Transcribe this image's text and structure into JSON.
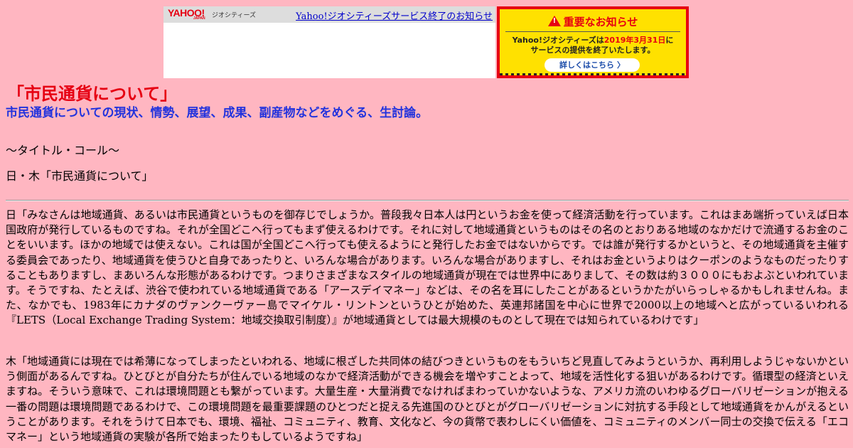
{
  "banner": {
    "logo_text": "YAHOO!",
    "logo_sub": "JAPAN",
    "service_label": "ジオシティーズ",
    "notice_link": "Yahoo!ジオシティーズサービス終了のお知らせ",
    "important_heading": "重要なお知らせ",
    "message_prefix": "Yahoo!ジオシティーズは",
    "message_date": "2019年3月31日",
    "message_mid": "に",
    "message_line2": "サービスの提供を終了いたします。",
    "detail_button": "詳しくはこちら",
    "detail_chevron": "〉",
    "colors": {
      "accent_red": "#e60012",
      "notice_yellow": "#ffe100",
      "link_blue": "#0000cc"
    }
  },
  "page": {
    "title": "「市民通貨について」",
    "subtitle": "市民通貨についての現状、情勢、展望、成果、副産物などをめぐる、生討論。",
    "title_call": "～タイトル・コール～",
    "speakers_line": "日・木「市民通貨について」",
    "colors": {
      "background": "#ffb6c1",
      "title": "#e60012",
      "subtitle": "#2233dd"
    }
  },
  "dialogue": [
    "日「みなさんは地域通貨、あるいは市民通貨というものを御存じでしょうか。普段我々日本人は円というお金を使って経済活動を行っています。これはまあ端折っていえば日本国政府が発行しているものですね。それが全国どこへ行ってもまず使えるわけです。それに対して地域通貨というものはその名のとおりある地域のなかだけで流通するお金のことをいいます。ほかの地域では使えない。これは国が全国どこへ行っても使えるようにと発行したお金ではないからです。では誰が発行するかというと、その地域通貨を主催する委員会であったり、地域通貨を使うひと自身であったりと、いろんな場合があります。いろんな場合がありますし、それはお金というよりはクーポンのようなものだったりすることもありますし、まあいろんな形態があるわけです。つまりさまざまなスタイルの地域通貨が現在では世界中にありまして、その数は約３０００にもおよぶといわれています。そうですね、たとえば、渋谷で使われている地域通貨である「アースデイマネー」などは、その名を耳にしたことがあるというかたがいらっしゃるかもしれませんね。また、なかでも、1983年にカナダのヴァンクーヴァー島でマイケル・リントンというひとが始めた、英連邦諸国を中心に世界で2000以上の地域へと広がっているいわれる『LETS（Local Exchange Trading System：地域交換取引制度）』が地域通貨としては最大規模のものとして現在では知られているわけです」",
    "木「地域通貨には現在では希薄になってしまったといわれる、地域に根ざした共同体の結びつきというものをもういちど見直してみようというか、再利用しようじゃないかという側面があるんですね。ひとびとが自分たちが住んでいる地域のなかで経済活動ができる機会を増やすことよって、地域を活性化する狙いがあるわけです。循環型の経済といえますね。そういう意味で、これは環境問題とも繋がっています。大量生産・大量消費でなければまわっていかないような、アメリカ流のいわゆるグローバリゼーションが抱える一番の問題は環境問題であるわけで、この環境問題を最重要課題のひとつだと捉える先進国のひとびとがグローバリゼーションに対抗する手段として地域通貨をかんがえるということがあります。それをうけて日本でも、環境、福祉、コミュニティ、教育、文化など、今の貨幣で表わしにくい価値を、コミュニティのメンバー同士の交換で伝える「エコマネー」という地域通貨の実験が各所で始まったりもしているようですね」"
  ]
}
